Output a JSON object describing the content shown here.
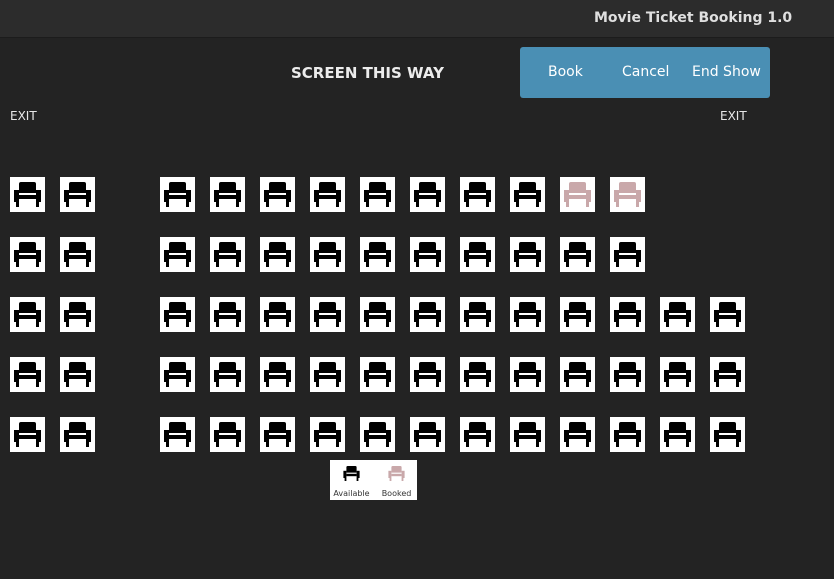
{
  "window": {
    "title": "Movie Ticket Booking 1.0"
  },
  "screen_label": "SCREEN THIS WAY",
  "actions": {
    "book": "Book",
    "cancel": "Cancel",
    "end_show": "End Show"
  },
  "exits": {
    "left": "EXIT",
    "right": "EXIT"
  },
  "colors": {
    "background": "#232323",
    "action_bar": "#4a8fb4",
    "seat_available": "#000000",
    "seat_booked": "#c9a8aa"
  },
  "seat_icon": "armchair-icon",
  "seating": {
    "rows": [
      {
        "left_block": [
          "available",
          "available"
        ],
        "right_block": [
          "available",
          "available",
          "available",
          "available",
          "available",
          "available",
          "available",
          "available",
          "booked",
          "booked"
        ]
      },
      {
        "left_block": [
          "available",
          "available"
        ],
        "right_block": [
          "available",
          "available",
          "available",
          "available",
          "available",
          "available",
          "available",
          "available",
          "available",
          "available"
        ]
      },
      {
        "left_block": [
          "available",
          "available"
        ],
        "right_block": [
          "available",
          "available",
          "available",
          "available",
          "available",
          "available",
          "available",
          "available",
          "available",
          "available",
          "available",
          "available"
        ]
      },
      {
        "left_block": [
          "available",
          "available"
        ],
        "right_block": [
          "available",
          "available",
          "available",
          "available",
          "available",
          "available",
          "available",
          "available",
          "available",
          "available",
          "available",
          "available"
        ]
      },
      {
        "left_block": [
          "available",
          "available"
        ],
        "right_block": [
          "available",
          "available",
          "available",
          "available",
          "available",
          "available",
          "available",
          "available",
          "available",
          "available",
          "available",
          "available"
        ]
      }
    ]
  },
  "legend": {
    "available": "Available",
    "booked": "Booked"
  }
}
